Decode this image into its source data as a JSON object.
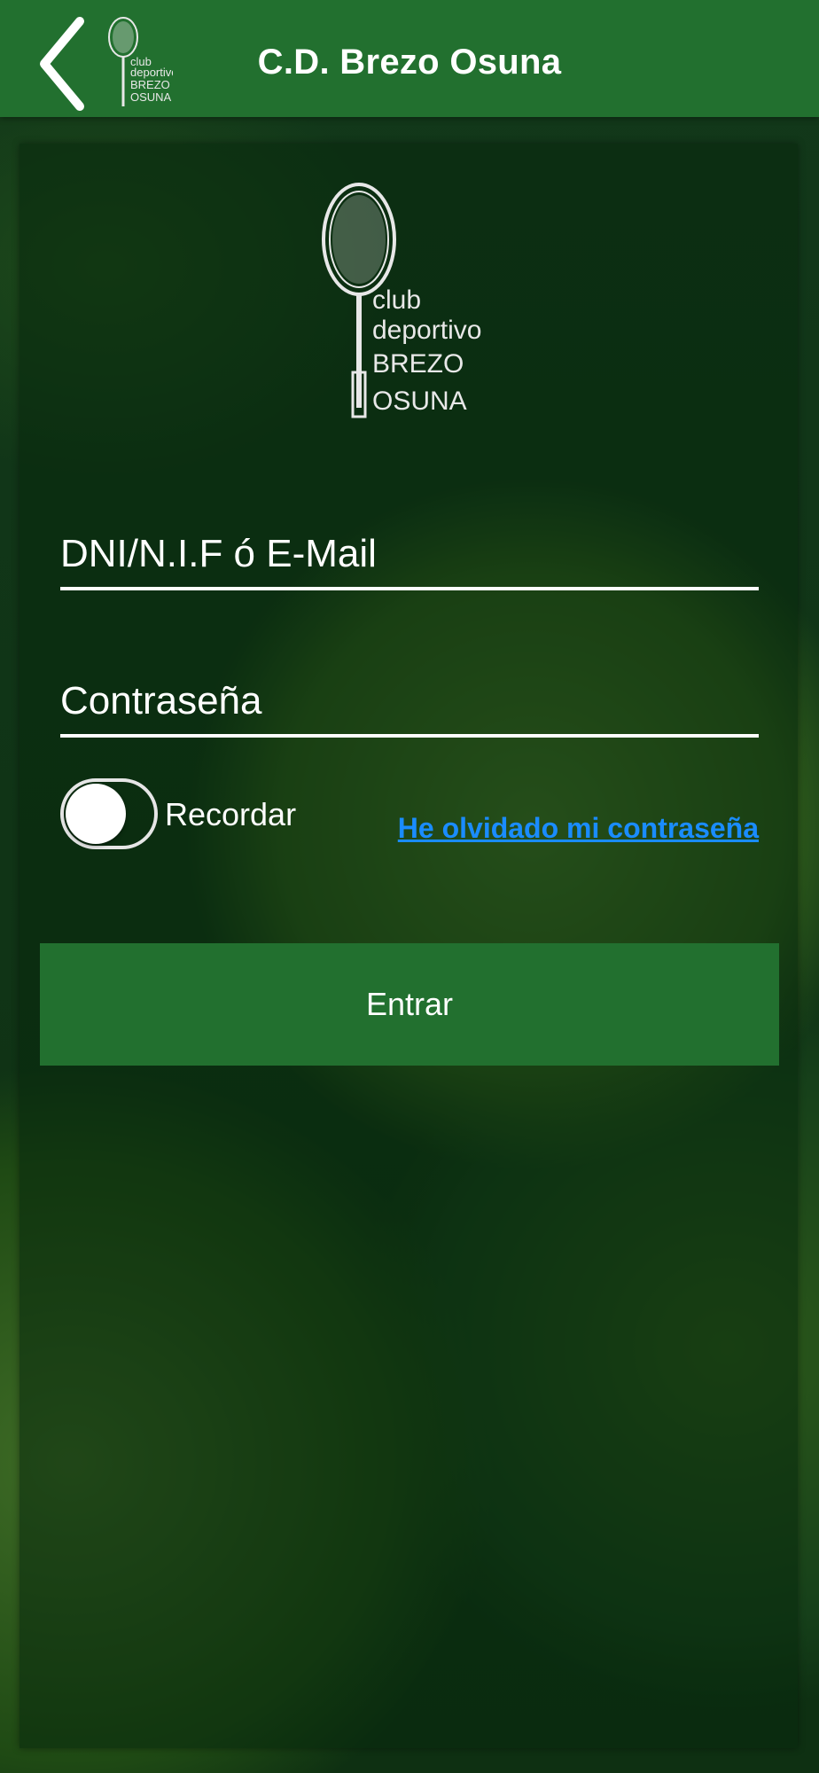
{
  "header": {
    "title": "C.D. Brezo Osuna",
    "back_icon": "chevron-left-icon",
    "logo_lines": [
      "club",
      "deportivo",
      "BREZO",
      "OSUNA"
    ]
  },
  "logo": {
    "lines": [
      "club",
      "deportivo",
      "BREZO",
      "OSUNA"
    ]
  },
  "form": {
    "user_placeholder": "DNI/N.I.F ó E-Mail",
    "user_value": "",
    "password_placeholder": "Contraseña",
    "password_value": "",
    "remember_label": "Recordar",
    "remember_on": false,
    "forgot_link": "He olvidado mi contraseña",
    "submit_label": "Entrar"
  },
  "colors": {
    "brand_green": "#22702f",
    "link_blue": "#1a8cff"
  }
}
